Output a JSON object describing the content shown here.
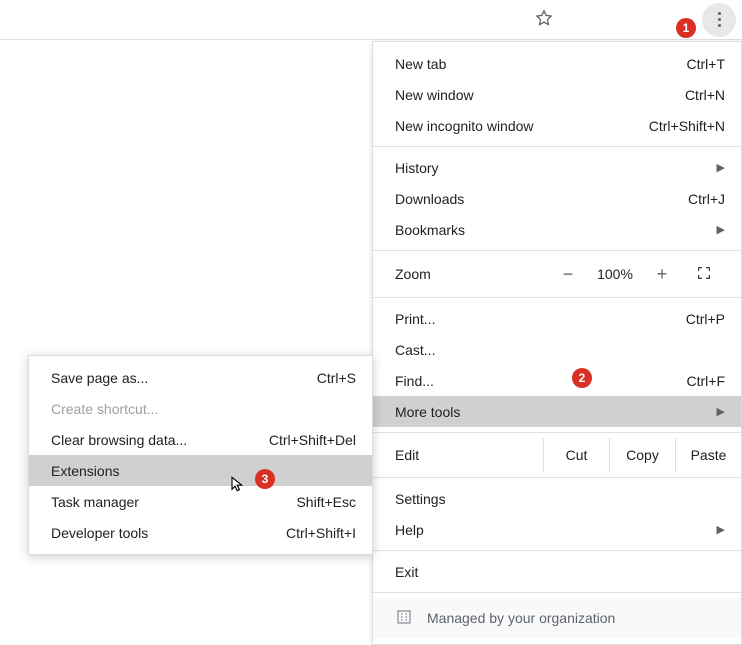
{
  "badges": {
    "b1": "1",
    "b2": "2",
    "b3": "3"
  },
  "menu": {
    "new_tab": "New tab",
    "new_tab_sc": "Ctrl+T",
    "new_window": "New window",
    "new_window_sc": "Ctrl+N",
    "new_incognito": "New incognito window",
    "new_incognito_sc": "Ctrl+Shift+N",
    "history": "History",
    "downloads": "Downloads",
    "downloads_sc": "Ctrl+J",
    "bookmarks": "Bookmarks",
    "zoom_label": "Zoom",
    "zoom_minus": "−",
    "zoom_value": "100%",
    "zoom_plus": "+",
    "print": "Print...",
    "print_sc": "Ctrl+P",
    "cast": "Cast...",
    "find": "Find...",
    "find_sc": "Ctrl+F",
    "more_tools": "More tools",
    "edit": "Edit",
    "cut": "Cut",
    "copy": "Copy",
    "paste": "Paste",
    "settings": "Settings",
    "help": "Help",
    "exit": "Exit",
    "managed": "Managed by your organization"
  },
  "submenu": {
    "save_page": "Save page as...",
    "save_page_sc": "Ctrl+S",
    "create_shortcut": "Create shortcut...",
    "clear_data": "Clear browsing data...",
    "clear_data_sc": "Ctrl+Shift+Del",
    "extensions": "Extensions",
    "task_manager": "Task manager",
    "task_manager_sc": "Shift+Esc",
    "dev_tools": "Developer tools",
    "dev_tools_sc": "Ctrl+Shift+I"
  }
}
